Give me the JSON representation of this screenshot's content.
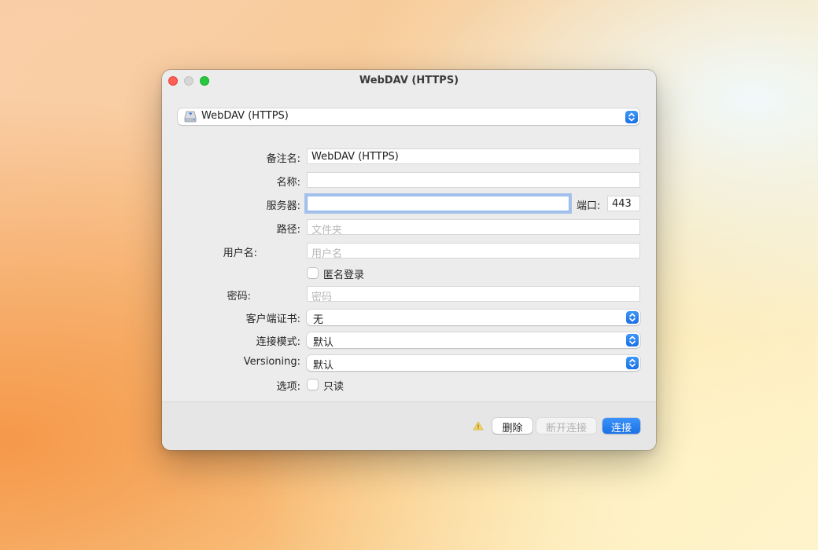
{
  "window": {
    "title": "WebDAV (HTTPS)"
  },
  "top_select": {
    "value": "WebDAV (HTTPS)",
    "icon": "network-disk-icon"
  },
  "form": {
    "nickname": {
      "label": "备注名:",
      "value": "WebDAV (HTTPS)"
    },
    "name": {
      "label": "名称:",
      "value": ""
    },
    "server": {
      "label": "服务器:",
      "value": ""
    },
    "port": {
      "label": "端口:",
      "value": "443"
    },
    "path": {
      "label": "路径:",
      "placeholder": "文件夹"
    },
    "username": {
      "label": "用户名:",
      "placeholder": "用户名"
    },
    "anonymous": {
      "label": "匿名登录",
      "checked": false
    },
    "password": {
      "label": "密码:",
      "placeholder": "密码"
    },
    "client_cert": {
      "label": "客户端证书:",
      "value": "无"
    },
    "connect_mode": {
      "label": "连接模式:",
      "value": "默认"
    },
    "versioning": {
      "label": "Versioning:",
      "value": "默认"
    },
    "options": {
      "label": "选项:",
      "readonly_label": "只读",
      "checked": false
    }
  },
  "footer": {
    "warning_icon": "warning-icon",
    "delete_label": "删除",
    "disconnect_label": "断开连接",
    "connect_label": "连接"
  },
  "colors": {
    "accent": "#1a71e7",
    "close": "#fe5f57",
    "zoom": "#28c840"
  }
}
